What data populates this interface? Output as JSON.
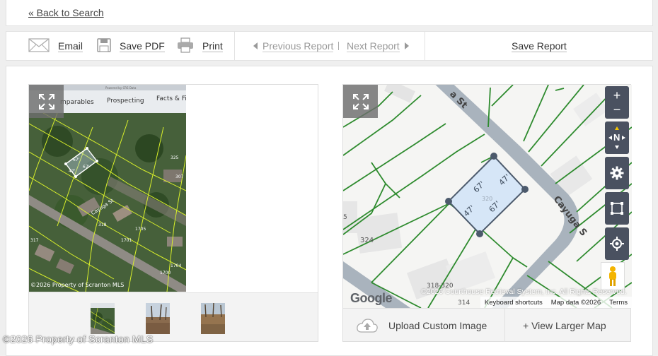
{
  "header": {
    "back_link": "« Back to Search"
  },
  "toolbar": {
    "email": "Email",
    "save_pdf": "Save PDF",
    "print": "Print",
    "previous_report": "Previous Report",
    "next_report": "Next Report",
    "save_report": "Save Report"
  },
  "photos": {
    "main_overlay": {
      "tabs": [
        "mparables",
        "Prospecting",
        "Facts & Fi"
      ],
      "powered_by": "Powered by CRS Data",
      "street": "Cayuga St",
      "lot_dims": [
        "67'",
        "67'",
        "47'"
      ],
      "copyright": "©2026 Property of Scranton MLS",
      "parcel_labels": [
        "325",
        "307",
        "1705",
        "1701",
        "317",
        "1704",
        "1700",
        "318"
      ]
    },
    "thumbnail_count": 3
  },
  "map": {
    "street_top": "a St",
    "street_right": "Cayuga S",
    "lot_dims": [
      "67'",
      "47'",
      "67'",
      "47'"
    ],
    "lot_number": "320",
    "neighbor_labels": [
      "324",
      "318-320",
      "314",
      "5"
    ],
    "compass": "N",
    "zoom_in": "+",
    "zoom_out": "−",
    "google_logo": "Google",
    "attribution": "©2026 Courthouse Retrieval System, Inc. All Rights Reserved.",
    "keyboard_shortcuts": "Keyboard shortcuts",
    "map_data": "Map data ©2026",
    "terms": "Terms",
    "upload_label": "Upload Custom Image",
    "larger_map_label": "+ View Larger Map"
  },
  "watermark": "©2026 Property of Scranton MLS",
  "colors": {
    "parcel_line": "#2e8b2e",
    "road": "#a9b3bd",
    "control_bg": "#4a5160",
    "lot_fill": "#d6e6f7"
  }
}
